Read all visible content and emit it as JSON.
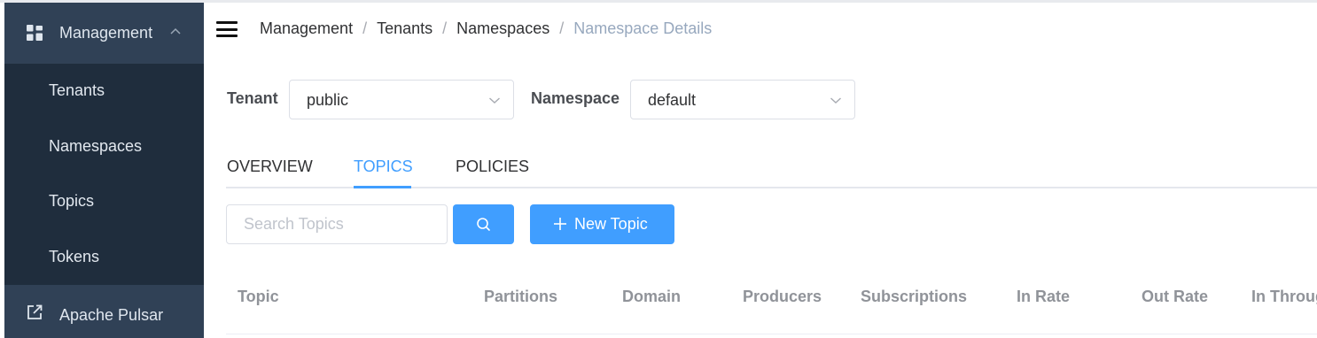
{
  "sidebar": {
    "section": {
      "label": "Management",
      "icon": "grid-icon",
      "expand_icon": "chevron-up-icon"
    },
    "items": [
      {
        "label": "Tenants"
      },
      {
        "label": "Namespaces"
      },
      {
        "label": "Topics"
      },
      {
        "label": "Tokens"
      }
    ],
    "external": {
      "label": "Apache Pulsar",
      "icon": "external-link-icon"
    }
  },
  "header": {
    "menu_icon": "hamburger-icon",
    "breadcrumb": [
      "Management",
      "Tenants",
      "Namespaces",
      "Namespace Details"
    ],
    "separator": "/"
  },
  "filters": {
    "tenant": {
      "label": "Tenant",
      "value": "public"
    },
    "namespace": {
      "label": "Namespace",
      "value": "default"
    }
  },
  "tabs": [
    {
      "label": "OVERVIEW",
      "active": false
    },
    {
      "label": "TOPICS",
      "active": true
    },
    {
      "label": "POLICIES",
      "active": false
    }
  ],
  "search": {
    "placeholder": "Search Topics",
    "value": "",
    "button_icon": "search-icon"
  },
  "new_topic_button": {
    "label": "New Topic",
    "icon": "plus-icon"
  },
  "table": {
    "columns": [
      "Topic",
      "Partitions",
      "Domain",
      "Producers",
      "Subscriptions",
      "In Rate",
      "Out Rate",
      "In Throug"
    ]
  },
  "colors": {
    "sidebar_bg": "#1f2d3d",
    "sidebar_section_bg": "#304156",
    "accent": "#409eff",
    "breadcrumb_current": "#97a8be",
    "table_header_text": "#909399"
  }
}
